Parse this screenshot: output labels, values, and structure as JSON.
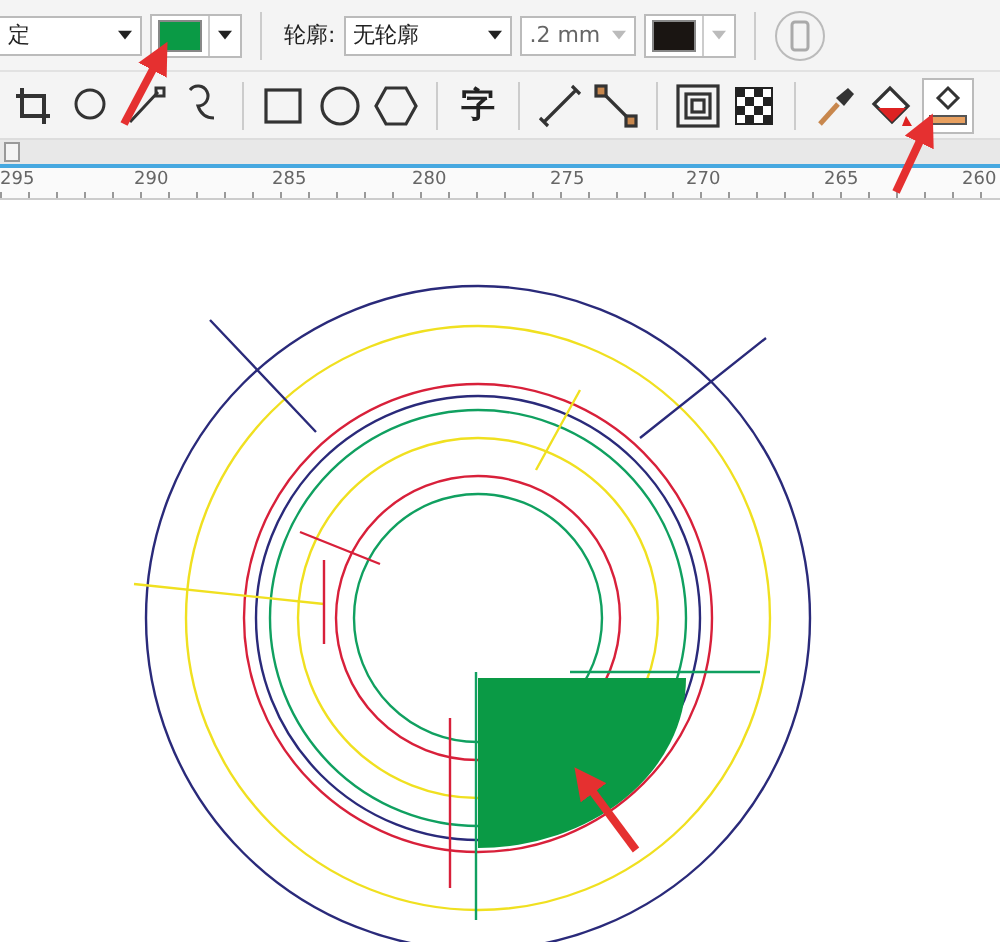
{
  "property_bar": {
    "fill_mode": "定",
    "fill_swatch": {
      "color": "#0a9a45"
    },
    "outline_label": "轮廓:",
    "outline_value": "无轮廓",
    "width_value": ".2 mm",
    "outline_swatch": {
      "color": "#1a1512"
    }
  },
  "toolbar": {
    "tools": [
      {
        "selected": false
      },
      {
        "selected": false
      },
      {
        "selected": false
      },
      {
        "selected": false
      },
      {
        "selected": false
      },
      {
        "selected": false
      },
      {
        "selected": false
      },
      {
        "label": "字",
        "selected": false
      },
      {
        "selected": false
      },
      {
        "selected": false
      },
      {
        "selected": false
      },
      {
        "selected": false
      },
      {
        "selected": false
      },
      {
        "selected": false
      },
      {
        "selected": true
      }
    ]
  },
  "ruler": {
    "labels": [
      "295",
      "290",
      "285",
      "280",
      "275",
      "270",
      "265",
      "260"
    ]
  }
}
